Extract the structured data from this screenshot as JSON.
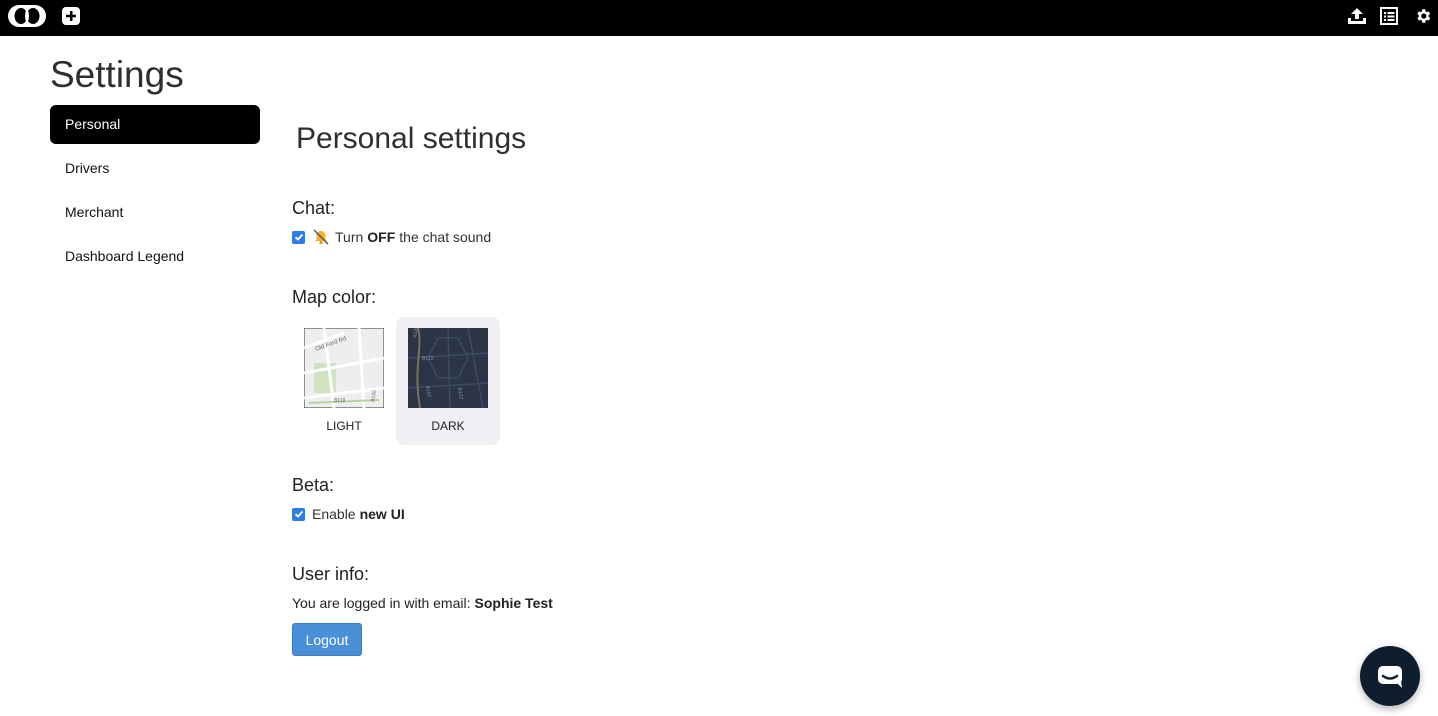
{
  "topbar": {
    "icons": [
      "logo-icon",
      "add-icon",
      "upload-icon",
      "list-icon",
      "gear-icon"
    ]
  },
  "page": {
    "title": "Settings"
  },
  "sidebar": {
    "items": [
      {
        "label": "Personal",
        "active": true
      },
      {
        "label": "Drivers",
        "active": false
      },
      {
        "label": "Merchant",
        "active": false
      },
      {
        "label": "Dashboard Legend",
        "active": false
      }
    ]
  },
  "main": {
    "title": "Personal settings",
    "chat": {
      "heading": "Chat:",
      "checked": true,
      "icon": "muted-bell-icon",
      "text_pre": "Turn",
      "text_bold": "OFF",
      "text_post": "the chat sound"
    },
    "map": {
      "heading": "Map color:",
      "options": [
        {
          "label": "LIGHT",
          "selected": false
        },
        {
          "label": "DARK",
          "selected": true
        }
      ],
      "light_map_labels": [
        "Old Ford Rd",
        "B119",
        "B120"
      ],
      "dark_map_labels": [
        "A1208",
        "B122",
        "A110",
        "B122"
      ]
    },
    "beta": {
      "heading": "Beta:",
      "checked": true,
      "text_pre": "Enable",
      "text_bold": "new UI"
    },
    "user": {
      "heading": "User info:",
      "text": "You are logged in with email:",
      "name": "Sophie Test",
      "logout_label": "Logout"
    }
  },
  "colors": {
    "topbar": "#000000",
    "active_nav": "#000000",
    "checkbox": "#2f7de1",
    "logout_button": "#4a90d9",
    "chat_widget": "#0f1e2e"
  }
}
